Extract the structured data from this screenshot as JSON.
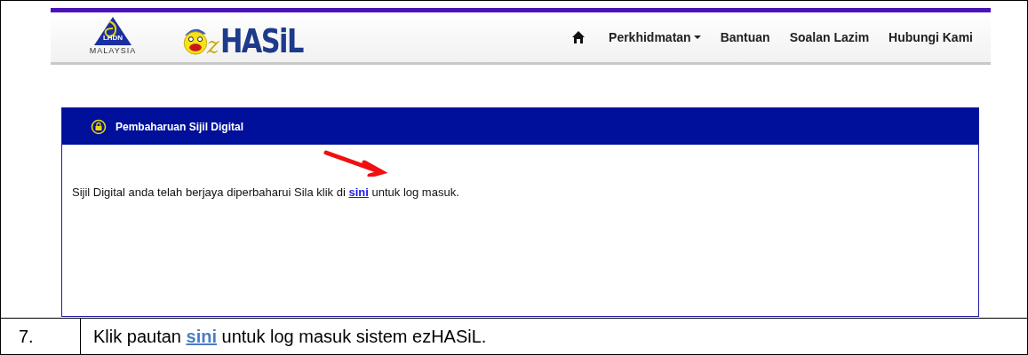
{
  "screenshot": {
    "logos": {
      "lhdn": {
        "emblem_text": "LHDN",
        "country": "MALAYSIA"
      },
      "ezhasil": {
        "prefix": "z",
        "word": "HASiL"
      }
    },
    "nav": [
      {
        "label": "Perkhidmatan",
        "dropdown": true
      },
      {
        "label": "Bantuan",
        "dropdown": false
      },
      {
        "label": "Soalan Lazim",
        "dropdown": false
      },
      {
        "label": "Hubungi Kami",
        "dropdown": false
      }
    ],
    "panel": {
      "title": "Pembaharuan Sijil Digital",
      "message": {
        "before": "Sijil Digital anda telah berjaya diperbaharui Sila klik di ",
        "link": "sini",
        "after": " untuk log masuk."
      }
    }
  },
  "step": {
    "number": "7.",
    "text": {
      "before": "Klik pautan ",
      "link": "sini",
      "after": " untuk log masuk sistem ezHASiL."
    }
  }
}
